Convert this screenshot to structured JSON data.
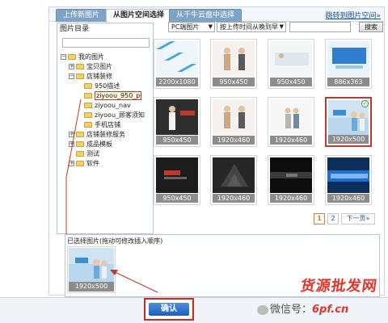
{
  "tabs": [
    {
      "label": "上传新图片"
    },
    {
      "label": "从图片空间选择"
    },
    {
      "label": "从千牛云盘中选择"
    }
  ],
  "top_link": "跳转到图片空间»",
  "folder_panel": {
    "title": "图片目录",
    "nodes": [
      {
        "label": "我的图片",
        "depth": 0,
        "toggle": "−"
      },
      {
        "label": "宝贝图片",
        "depth": 1,
        "toggle": "+"
      },
      {
        "label": "店铺装修",
        "depth": 1,
        "toggle": "−"
      },
      {
        "label": "950描述",
        "depth": 2,
        "toggle": ""
      },
      {
        "label": "ziyoou_950_p",
        "depth": 2,
        "toggle": "",
        "selected": true
      },
      {
        "label": "ziyoou_nav",
        "depth": 2,
        "toggle": ""
      },
      {
        "label": "ziyoou_顾客须知",
        "depth": 2,
        "toggle": ""
      },
      {
        "label": "手机店铺",
        "depth": 2,
        "toggle": ""
      },
      {
        "label": "店铺装修服务",
        "depth": 1,
        "toggle": "+"
      },
      {
        "label": "成品模板",
        "depth": 1,
        "toggle": "+"
      },
      {
        "label": "测试",
        "depth": 1,
        "toggle": ""
      },
      {
        "label": "软件",
        "depth": 1,
        "toggle": "+"
      }
    ]
  },
  "filters": {
    "type_select": "PC端图片",
    "sort_select": "按上传时间从晚到早",
    "search_button": "搜索"
  },
  "images": [
    {
      "size": "2200x1080",
      "style": "stripes",
      "selected": false
    },
    {
      "size": "950x450",
      "style": "people",
      "selected": false
    },
    {
      "size": "950x450",
      "style": "light",
      "selected": false
    },
    {
      "size": "886x363",
      "style": "blue",
      "selected": false
    },
    {
      "size": "950x450",
      "style": "dark-people",
      "selected": false
    },
    {
      "size": "1920x460",
      "style": "people",
      "selected": false
    },
    {
      "size": "1920x460",
      "style": "people-light",
      "selected": false
    },
    {
      "size": "1920x500",
      "style": "banner",
      "selected": true
    },
    {
      "size": "950x450",
      "style": "dark",
      "selected": false
    },
    {
      "size": "1920x460",
      "style": "dark2",
      "selected": false
    },
    {
      "size": "1920x460",
      "style": "dark3",
      "selected": false
    },
    {
      "size": "1920x460",
      "style": "blue2",
      "selected": false
    }
  ],
  "pagination": {
    "current": "1",
    "next_page": "2",
    "next_label": "下一页»"
  },
  "selected_section": {
    "title": "已选择图片(拖动可修改插入顺序)",
    "items": [
      {
        "size": "1920x500"
      }
    ]
  },
  "confirm_button": "确认",
  "watermark": {
    "brand": "货源批发网",
    "prefix": "微信号：",
    "domain": "6pf.cn"
  }
}
